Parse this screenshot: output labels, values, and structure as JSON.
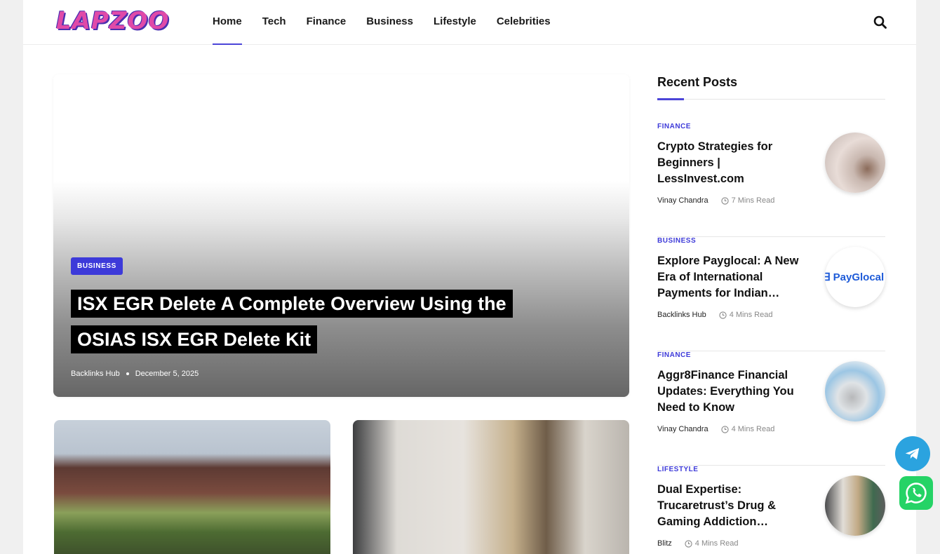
{
  "header": {
    "logo_text": "LAPZOO",
    "nav": [
      {
        "label": "Home",
        "active": true
      },
      {
        "label": "Tech"
      },
      {
        "label": "Finance"
      },
      {
        "label": "Business"
      },
      {
        "label": "Lifestyle"
      },
      {
        "label": "Celebrities"
      }
    ],
    "search_icon": "search-icon"
  },
  "hero": {
    "category": "BUSINESS",
    "title": "ISX EGR Delete  A Complete Overview Using the OSIAS ISX EGR Delete Kit",
    "author": "Backlinks Hub",
    "date": "December 5, 2025"
  },
  "sidebar": {
    "title": "Recent Posts",
    "posts": [
      {
        "category": "FINANCE",
        "title": "Crypto Strategies for Beginners | LessInvest.com",
        "author": "Vinay Chandra",
        "read_time": "7 Mins Read"
      },
      {
        "category": "BUSINESS",
        "title": "Explore Payglocal: A New Era of International Payments for Indian…",
        "author": "Backlinks Hub",
        "read_time": "4 Mins Read",
        "thumb_text": "PayGlocal"
      },
      {
        "category": "FINANCE",
        "title": "Aggr8Finance Financial Updates: Everything You Need to Know",
        "author": "Vinay Chandra",
        "read_time": "4 Mins Read"
      },
      {
        "category": "LIFESTYLE",
        "title": "Dual Expertise: Trucaretrust’s Drug & Gaming Addiction…",
        "author": "Blitz",
        "read_time": "4 Mins Read"
      }
    ]
  },
  "colors": {
    "accent": "#3d3ad9",
    "telegram": "#2ba3df",
    "whatsapp": "#25d366"
  }
}
